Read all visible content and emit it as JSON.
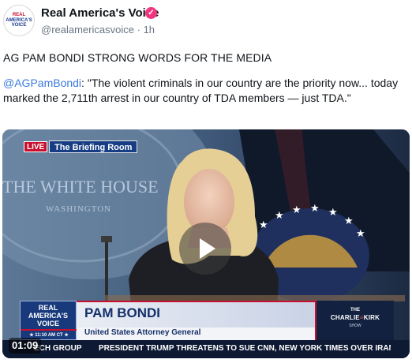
{
  "post": {
    "author_name": "Real America's Voice",
    "handle": "@realamericasvoice",
    "time_ago": "1h",
    "separator": "·",
    "avatar_lines": [
      "REAL",
      "AMERICA'S",
      "VOICE"
    ],
    "headline": "AG PAM BONDI STRONG WORDS FOR THE MEDIA",
    "mention": "@AGPamBondi",
    "body": ": \"The violent criminals in our country are the priority now... today marked the 2,711th arrest in our country of TDA members — just TDA.\""
  },
  "video": {
    "live_label": "LIVE",
    "room_label": "The Briefing Room",
    "backdrop_text_1": "THE WHITE HOUSE",
    "backdrop_text_2": "WASHINGTON",
    "logo_lines": [
      "REAL",
      "AMERICA'S",
      "VOICE"
    ],
    "logo_time": "★ 11:10 AM CT ★",
    "speaker_name": "PAM BONDI",
    "speaker_title": "United States Attorney General",
    "show_prefix": "THE",
    "show_name_1": "CHARLIE",
    "show_name_sep": "≡",
    "show_name_2": "KIRK",
    "show_suffix": "SHOW",
    "ticker_left": "ECH GROUP",
    "ticker_text": "PRESIDENT TRUMP THREATENS TO SUE CNN, NEW YORK TIMES OVER IRAN INTELLIGENCE",
    "timestamp": "01:09"
  },
  "colors": {
    "verified_badge": "#f0367f",
    "mention": "#3a7ae0",
    "brand_blue": "#173e84",
    "brand_red": "#c8102e"
  },
  "icons": {
    "verified": "verified-badge-icon",
    "play": "play-icon"
  }
}
